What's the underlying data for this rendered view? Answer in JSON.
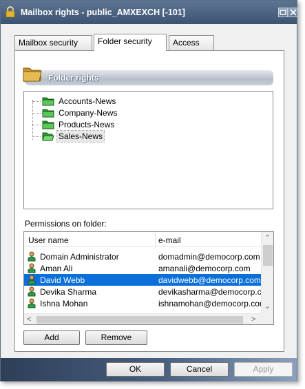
{
  "window": {
    "title": "Mailbox rights - public_AMXEXCH [-101]"
  },
  "tabs": [
    {
      "label": "Mailbox security",
      "active": false
    },
    {
      "label": "Folder security",
      "active": true
    },
    {
      "label": "Access",
      "active": false
    }
  ],
  "folder_rights": {
    "title": "Folder rights",
    "tree": [
      {
        "label": "Accounts-News",
        "selected": false
      },
      {
        "label": "Company-News",
        "selected": false
      },
      {
        "label": "Products-News",
        "selected": false
      },
      {
        "label": "Sales-News",
        "selected": true
      }
    ]
  },
  "permissions": {
    "label": "Permissions on folder:",
    "columns": [
      "User name",
      "e-mail"
    ],
    "rows": [
      {
        "name": "Domain Administrator",
        "email": "domadmin@democorp.com",
        "selected": false
      },
      {
        "name": "Aman Ali",
        "email": "amanali@democorp.com",
        "selected": false
      },
      {
        "name": "David Webb",
        "email": "davidwebb@democorp.com",
        "selected": true
      },
      {
        "name": "Devika Sharma",
        "email": "devikasharma@democorp.coi",
        "selected": false
      },
      {
        "name": "Ishna Mohan",
        "email": "ishnamohan@democorp.com",
        "selected": false
      }
    ],
    "add_label": "Add",
    "remove_label": "Remove"
  },
  "footer": {
    "ok_label": "OK",
    "cancel_label": "Cancel",
    "apply_label": "Apply",
    "apply_enabled": false
  },
  "colors": {
    "titlebar": "#4a6282",
    "selection": "#0a6fd8",
    "folder": "#3aa53a"
  }
}
